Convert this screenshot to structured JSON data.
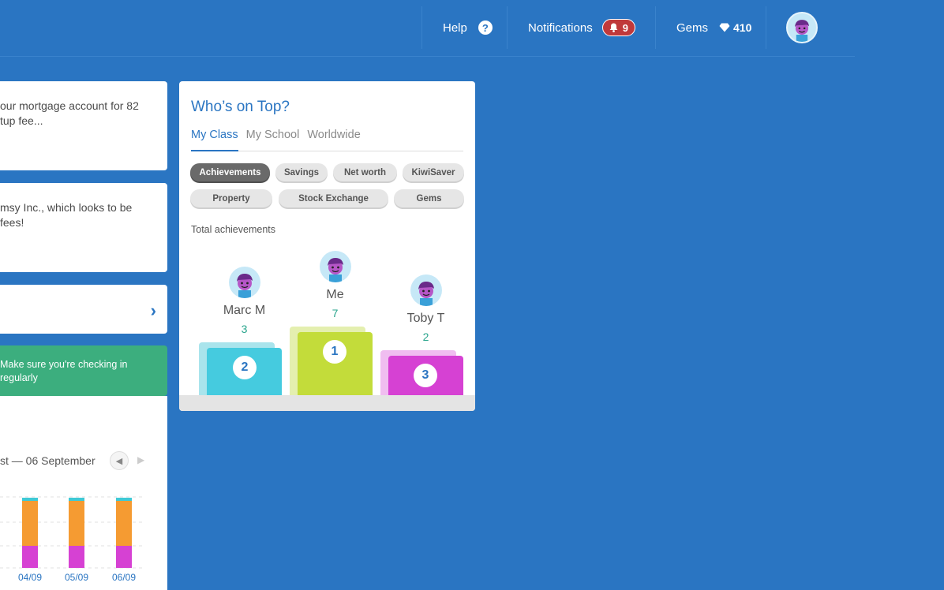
{
  "topbar": {
    "help_label": "Help",
    "help_icon": "question-mark-icon",
    "notifications_label": "Notifications",
    "notifications_count": "9",
    "gems_label": "Gems",
    "gems_count": "410"
  },
  "left": {
    "card1_text": [
      "our mortgage account for 82",
      "tup fee..."
    ],
    "card2_text": [
      "msy Inc., which looks to be",
      "fees!"
    ],
    "reminder_text": [
      "Make sure you're checking in",
      "regularly"
    ],
    "date_range": "st — 06 September",
    "chart_data": {
      "type": "bar",
      "categories": [
        "04/09",
        "05/09",
        "06/09"
      ]
    }
  },
  "leaderboard": {
    "title": "Who’s on Top?",
    "tabs": [
      "My Class",
      "My School",
      "Worldwide"
    ],
    "filters": [
      "Achievements",
      "Savings",
      "Net worth",
      "KiwiSaver",
      "Property",
      "Stock Exchange",
      "Gems"
    ],
    "subtitle": "Total achievements",
    "podium": [
      {
        "name": "Marc M",
        "score": "3",
        "rank": "2",
        "color": "#45cbdf"
      },
      {
        "name": "Me",
        "score": "7",
        "rank": "1",
        "color": "#c3dc3a"
      },
      {
        "name": "Toby T",
        "score": "2",
        "rank": "3",
        "color": "#d641d3"
      }
    ]
  }
}
